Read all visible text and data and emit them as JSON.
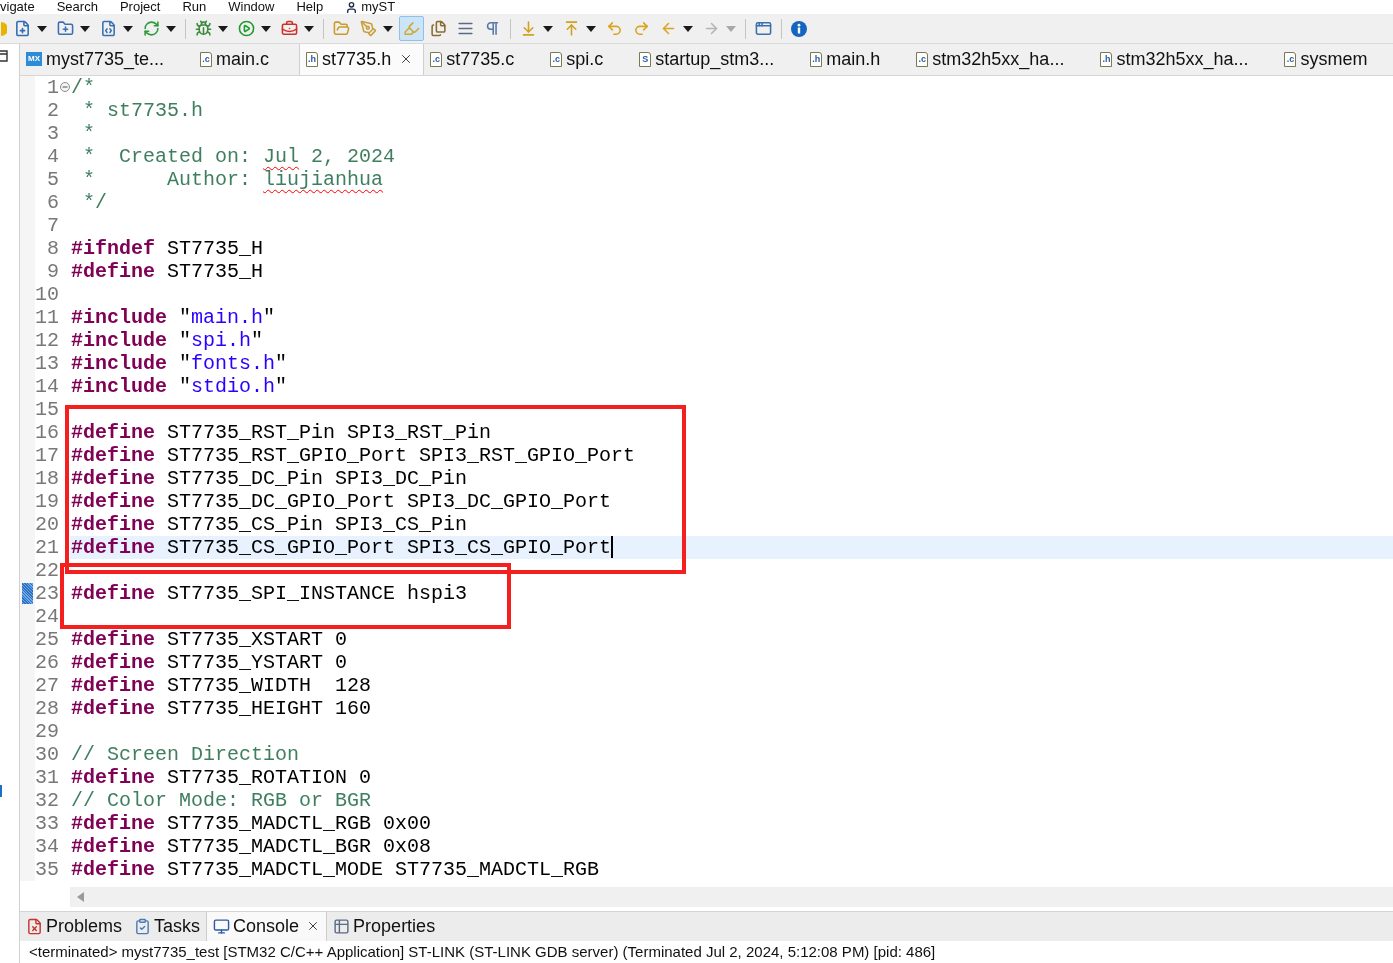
{
  "menu": {
    "items": [
      "vigate",
      "Search",
      "Project",
      "Run",
      "Window",
      "Help"
    ],
    "perspective": "myST"
  },
  "toolbar": [
    {
      "kind": "button",
      "dropdown": false,
      "pressed": false,
      "disabled": false
    },
    {
      "kind": "button",
      "dropdown": true,
      "pressed": false,
      "disabled": false
    },
    {
      "kind": "button",
      "dropdown": true,
      "pressed": false,
      "disabled": false
    },
    {
      "kind": "button",
      "dropdown": true,
      "pressed": false,
      "disabled": false
    },
    {
      "kind": "button",
      "dropdown": true,
      "pressed": false,
      "disabled": false
    },
    {
      "kind": "separator"
    },
    {
      "kind": "button",
      "dropdown": true,
      "pressed": false,
      "disabled": false
    },
    {
      "kind": "button",
      "dropdown": true,
      "pressed": false,
      "disabled": false
    },
    {
      "kind": "button",
      "dropdown": true,
      "pressed": false,
      "disabled": false
    },
    {
      "kind": "separator"
    },
    {
      "kind": "button",
      "dropdown": false,
      "pressed": false,
      "disabled": false
    },
    {
      "kind": "button",
      "dropdown": true,
      "pressed": false,
      "disabled": false
    },
    {
      "kind": "button",
      "dropdown": false,
      "pressed": true,
      "disabled": false
    },
    {
      "kind": "button",
      "dropdown": false,
      "pressed": false,
      "disabled": false
    },
    {
      "kind": "button",
      "dropdown": false,
      "pressed": false,
      "disabled": false
    },
    {
      "kind": "button",
      "dropdown": false,
      "pressed": false,
      "disabled": false
    },
    {
      "kind": "separator"
    },
    {
      "kind": "button",
      "dropdown": true,
      "pressed": false,
      "disabled": false
    },
    {
      "kind": "button",
      "dropdown": true,
      "pressed": false,
      "disabled": false
    },
    {
      "kind": "button",
      "dropdown": false,
      "pressed": false,
      "disabled": false
    },
    {
      "kind": "button",
      "dropdown": false,
      "pressed": false,
      "disabled": false
    },
    {
      "kind": "button",
      "dropdown": true,
      "pressed": false,
      "disabled": false
    },
    {
      "kind": "button",
      "dropdown": true,
      "pressed": false,
      "disabled": true
    },
    {
      "kind": "separator"
    },
    {
      "kind": "button",
      "dropdown": false,
      "pressed": false,
      "disabled": false
    },
    {
      "kind": "separator"
    },
    {
      "kind": "button",
      "dropdown": false,
      "pressed": false,
      "disabled": false
    }
  ],
  "editor_tabs": [
    {
      "label": "myst7735_te...",
      "icon": {
        "kind": "badge",
        "text": "MX"
      },
      "selected": false
    },
    {
      "label": "main.c",
      "icon": {
        "kind": "file",
        "text": ".c"
      },
      "selected": false
    },
    {
      "label": "st7735.h",
      "icon": {
        "kind": "file",
        "text": ".h"
      },
      "selected": true
    },
    {
      "label": "st7735.c",
      "icon": {
        "kind": "file",
        "text": ".c"
      },
      "selected": false
    },
    {
      "label": "spi.c",
      "icon": {
        "kind": "file",
        "text": ".c"
      },
      "selected": false
    },
    {
      "label": "startup_stm3...",
      "icon": {
        "kind": "file",
        "text": "S"
      },
      "selected": false
    },
    {
      "label": "main.h",
      "icon": {
        "kind": "file",
        "text": ".h"
      },
      "selected": false
    },
    {
      "label": "stm32h5xx_ha...",
      "icon": {
        "kind": "file",
        "text": ".c"
      },
      "selected": false
    },
    {
      "label": "stm32h5xx_ha...",
      "icon": {
        "kind": "file",
        "text": ".h"
      },
      "selected": false
    },
    {
      "label": "sysmem",
      "icon": {
        "kind": "file",
        "text": ".c"
      },
      "selected": false
    }
  ],
  "editor": {
    "lines": [
      {
        "number": "1",
        "fold_expanded": true,
        "current": false,
        "marked": false,
        "tokens": [
          {
            "kind": "comment",
            "text": "/*"
          }
        ]
      },
      {
        "number": "2",
        "current": false,
        "marked": false,
        "tokens": [
          {
            "kind": "comment",
            "text": " * st7735.h"
          }
        ]
      },
      {
        "number": "3",
        "current": false,
        "marked": false,
        "tokens": [
          {
            "kind": "comment",
            "text": " *"
          }
        ]
      },
      {
        "number": "4",
        "current": false,
        "marked": false,
        "tokens": [
          {
            "kind": "comment",
            "text": " *  Created on: "
          },
          {
            "kind": "misspelled",
            "text": "Jul"
          },
          {
            "kind": "comment",
            "text": " 2, 2024"
          }
        ]
      },
      {
        "number": "5",
        "current": false,
        "marked": false,
        "tokens": [
          {
            "kind": "comment",
            "text": " *      Author: "
          },
          {
            "kind": "misspelled",
            "text": "liujianhua"
          }
        ]
      },
      {
        "number": "6",
        "current": false,
        "marked": false,
        "tokens": [
          {
            "kind": "comment",
            "text": " */"
          }
        ]
      },
      {
        "number": "7",
        "current": false,
        "marked": false
      },
      {
        "number": "8",
        "current": false,
        "marked": false,
        "tokens": [
          {
            "kind": "keyword",
            "text": "#ifndef"
          },
          {
            "kind": "text",
            "text": " ST7735_H"
          }
        ]
      },
      {
        "number": "9",
        "current": false,
        "marked": false,
        "tokens": [
          {
            "kind": "keyword",
            "text": "#define"
          },
          {
            "kind": "text",
            "text": " ST7735_H"
          }
        ]
      },
      {
        "number": "10",
        "current": false,
        "marked": false
      },
      {
        "number": "11",
        "current": false,
        "marked": false,
        "tokens": [
          {
            "kind": "keyword",
            "text": "#include"
          },
          {
            "kind": "text",
            "text": " \""
          },
          {
            "kind": "string",
            "text": "main.h"
          },
          {
            "kind": "text",
            "text": "\""
          }
        ]
      },
      {
        "number": "12",
        "current": false,
        "marked": false,
        "tokens": [
          {
            "kind": "keyword",
            "text": "#include"
          },
          {
            "kind": "text",
            "text": " \""
          },
          {
            "kind": "string",
            "text": "spi.h"
          },
          {
            "kind": "text",
            "text": "\""
          }
        ]
      },
      {
        "number": "13",
        "current": false,
        "marked": false,
        "tokens": [
          {
            "kind": "keyword",
            "text": "#include"
          },
          {
            "kind": "text",
            "text": " \""
          },
          {
            "kind": "string",
            "text": "fonts.h"
          },
          {
            "kind": "text",
            "text": "\""
          }
        ]
      },
      {
        "number": "14",
        "current": false,
        "marked": false,
        "tokens": [
          {
            "kind": "keyword",
            "text": "#include"
          },
          {
            "kind": "text",
            "text": " \""
          },
          {
            "kind": "string",
            "text": "stdio.h"
          },
          {
            "kind": "text",
            "text": "\""
          }
        ]
      },
      {
        "number": "15",
        "current": false,
        "marked": false
      },
      {
        "number": "16",
        "current": false,
        "marked": false,
        "tokens": [
          {
            "kind": "keyword",
            "text": "#define"
          },
          {
            "kind": "text",
            "text": " ST7735_RST_Pin SPI3_RST_Pin"
          }
        ]
      },
      {
        "number": "17",
        "current": false,
        "marked": false,
        "tokens": [
          {
            "kind": "keyword",
            "text": "#define"
          },
          {
            "kind": "text",
            "text": " ST7735_RST_GPIO_Port SPI3_RST_GPIO_Port"
          }
        ]
      },
      {
        "number": "18",
        "current": false,
        "marked": false,
        "tokens": [
          {
            "kind": "keyword",
            "text": "#define"
          },
          {
            "kind": "text",
            "text": " ST7735_DC_Pin SPI3_DC_Pin"
          }
        ]
      },
      {
        "number": "19",
        "current": false,
        "marked": false,
        "tokens": [
          {
            "kind": "keyword",
            "text": "#define"
          },
          {
            "kind": "text",
            "text": " ST7735_DC_GPIO_Port SPI3_DC_GPIO_Port"
          }
        ]
      },
      {
        "number": "20",
        "current": false,
        "marked": false,
        "tokens": [
          {
            "kind": "keyword",
            "text": "#define"
          },
          {
            "kind": "text",
            "text": " ST7735_CS_Pin SPI3_CS_Pin"
          }
        ]
      },
      {
        "number": "21",
        "current": true,
        "marked": false,
        "tokens": [
          {
            "kind": "keyword",
            "text": "#define"
          },
          {
            "kind": "text",
            "text": " ST7735_CS_GPIO_Port SPI3_CS_GPIO_Port"
          }
        ]
      },
      {
        "number": "22",
        "current": false,
        "marked": false
      },
      {
        "number": "23",
        "current": false,
        "marked": true,
        "tokens": [
          {
            "kind": "keyword",
            "text": "#define"
          },
          {
            "kind": "text",
            "text": " ST7735_SPI_INSTANCE hspi3"
          }
        ]
      },
      {
        "number": "24",
        "current": false,
        "marked": false
      },
      {
        "number": "25",
        "current": false,
        "marked": false,
        "tokens": [
          {
            "kind": "keyword",
            "text": "#define"
          },
          {
            "kind": "text",
            "text": " ST7735_XSTART 0"
          }
        ]
      },
      {
        "number": "26",
        "current": false,
        "marked": false,
        "tokens": [
          {
            "kind": "keyword",
            "text": "#define"
          },
          {
            "kind": "text",
            "text": " ST7735_YSTART 0"
          }
        ]
      },
      {
        "number": "27",
        "current": false,
        "marked": false,
        "tokens": [
          {
            "kind": "keyword",
            "text": "#define"
          },
          {
            "kind": "text",
            "text": " ST7735_WIDTH  128"
          }
        ]
      },
      {
        "number": "28",
        "current": false,
        "marked": false,
        "tokens": [
          {
            "kind": "keyword",
            "text": "#define"
          },
          {
            "kind": "text",
            "text": " ST7735_HEIGHT 160"
          }
        ]
      },
      {
        "number": "29",
        "current": false,
        "marked": false
      },
      {
        "number": "30",
        "current": false,
        "marked": false,
        "tokens": [
          {
            "kind": "comment",
            "text": "// Screen Direction"
          }
        ]
      },
      {
        "number": "31",
        "current": false,
        "marked": false,
        "tokens": [
          {
            "kind": "keyword",
            "text": "#define"
          },
          {
            "kind": "text",
            "text": " ST7735_ROTATION 0"
          }
        ]
      },
      {
        "number": "32",
        "current": false,
        "marked": false,
        "tokens": [
          {
            "kind": "comment",
            "text": "// Color Mode: RGB or BGR"
          }
        ]
      },
      {
        "number": "33",
        "current": false,
        "marked": false,
        "tokens": [
          {
            "kind": "keyword",
            "text": "#define"
          },
          {
            "kind": "text",
            "text": " ST7735_MADCTL_RGB 0x00"
          }
        ]
      },
      {
        "number": "34",
        "current": false,
        "marked": false,
        "tokens": [
          {
            "kind": "keyword",
            "text": "#define"
          },
          {
            "kind": "text",
            "text": " ST7735_MADCTL_BGR 0x08"
          }
        ]
      },
      {
        "number": "35",
        "current": false,
        "marked": false,
        "tokens": [
          {
            "kind": "keyword",
            "text": "#define"
          },
          {
            "kind": "text",
            "text": " ST7735_MADCTL_MODE ST7735_MADCTL_RGB"
          }
        ]
      }
    ]
  },
  "bottom_panel": {
    "tabs": [
      {
        "label": "Problems",
        "selected": false
      },
      {
        "label": "Tasks",
        "selected": false
      },
      {
        "label": "Console",
        "selected": true
      },
      {
        "label": "Properties",
        "selected": false
      }
    ],
    "console_line": "<terminated> myst7735_test [STM32 C/C++ Application] ST-LINK (ST-LINK GDB server) (Terminated Jul 2, 2024, 5:12:08 PM) [pid: 486]"
  }
}
